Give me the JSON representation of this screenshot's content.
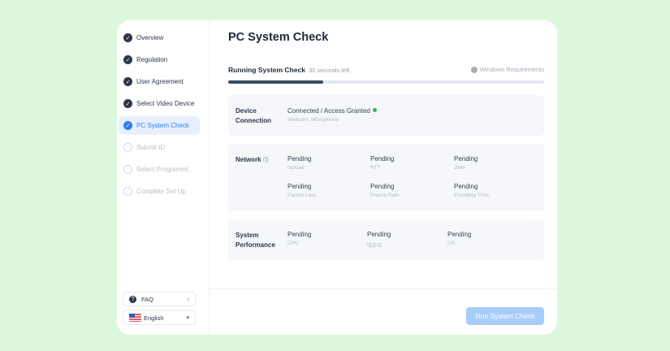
{
  "sidebar": {
    "items": [
      {
        "label": "Overview",
        "state": "done"
      },
      {
        "label": "Regulation",
        "state": "done"
      },
      {
        "label": "User Agreement",
        "state": "done"
      },
      {
        "label": "Select Video Device",
        "state": "done"
      },
      {
        "label": "PC System Check",
        "state": "active"
      },
      {
        "label": "Submit ID",
        "state": "pending"
      },
      {
        "label": "Select Programml...",
        "state": "pending"
      },
      {
        "label": "Complete Set Up",
        "state": "pending"
      }
    ],
    "faq": "FAQ",
    "language": "English"
  },
  "main": {
    "title": "PC System Check",
    "running": "Running System Check",
    "time_left": "30 seconds left",
    "windows_req": "Windows Requirements",
    "progress_percent": 30,
    "device": {
      "label_1": "Device",
      "label_2": "Connection",
      "value": "Connected / Access Granted",
      "sub": "Webcam, Microphone",
      "status_color": "#34b24a"
    },
    "network": {
      "label": "Network",
      "items": [
        {
          "value": "Pending",
          "sub": "Upload"
        },
        {
          "value": "Pending",
          "sub": "RTT"
        },
        {
          "value": "Pending",
          "sub": "Jitter"
        },
        {
          "value": "Pending",
          "sub": "Packet Loss"
        },
        {
          "value": "Pending",
          "sub": "Freeze Rate"
        },
        {
          "value": "Pending",
          "sub": "Encoding Time"
        }
      ]
    },
    "performance": {
      "label_1": "System",
      "label_2": "Performance",
      "items": [
        {
          "value": "Pending",
          "sub": "CPU"
        },
        {
          "value": "Pending",
          "sub": "메모리"
        },
        {
          "value": "Pending",
          "sub": "OS"
        }
      ]
    },
    "run_button": "Run System Check"
  }
}
